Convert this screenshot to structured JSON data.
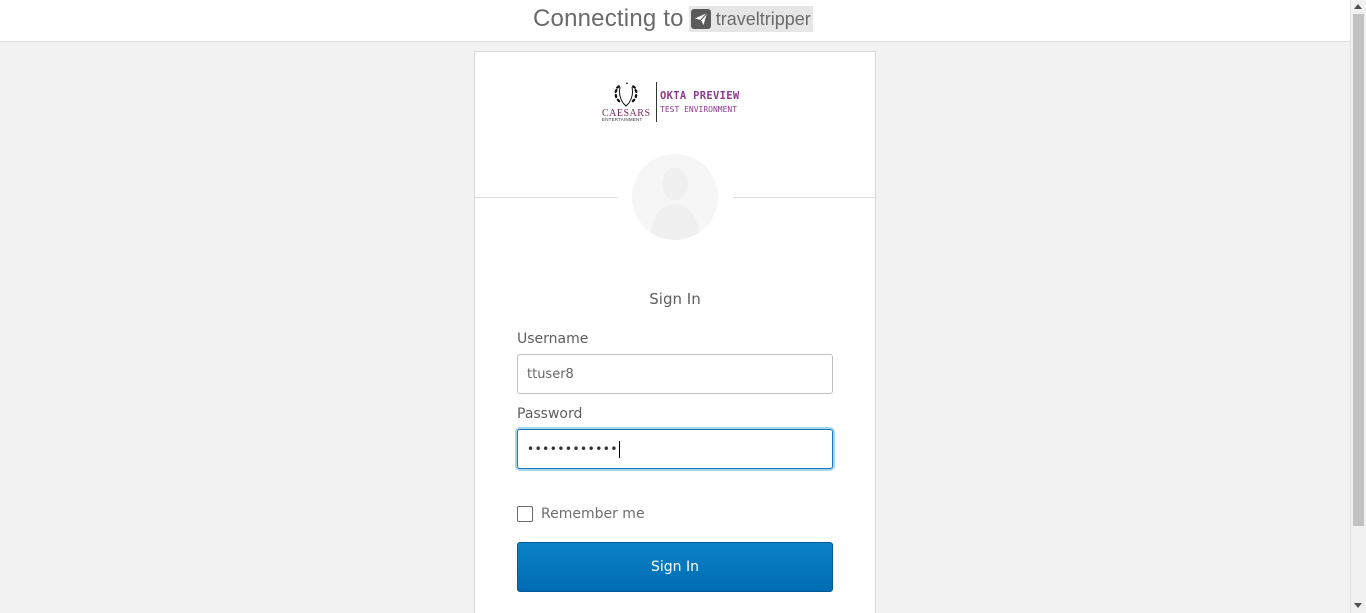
{
  "header": {
    "connecting_text": "Connecting to",
    "brand_name": "traveltripper",
    "brand_icon": "paper-plane-icon"
  },
  "logo": {
    "company": "CAESARS",
    "company_sub": "ENTERTAINMENT",
    "env_title": "OKTA PREVIEW",
    "env_subtitle": "TEST ENVIRONMENT"
  },
  "form": {
    "title": "Sign In",
    "username_label": "Username",
    "username_value": "ttuser8",
    "password_label": "Password",
    "password_value": "••••••••••••",
    "remember_label": "Remember me",
    "submit_label": "Sign In"
  },
  "colors": {
    "primary_button": "#0079c1",
    "focus_border": "#1c75bc",
    "env_text": "#8e3b8e"
  }
}
